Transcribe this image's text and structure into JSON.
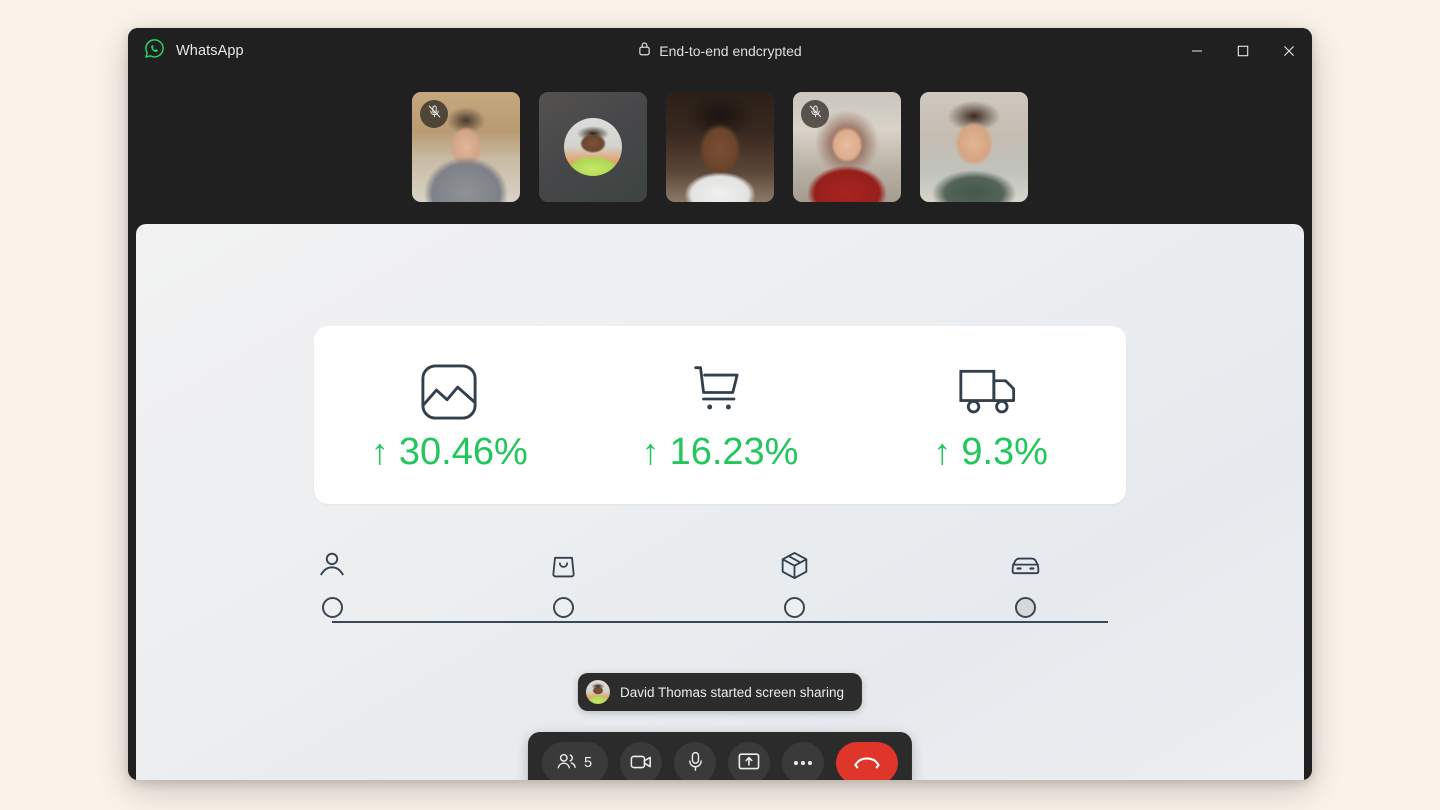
{
  "window": {
    "app_name": "WhatsApp",
    "encryption_label": "End-to-end endcrypted",
    "lock_icon": "lock-icon",
    "brand_icon": "whatsapp-logo-icon",
    "controls": {
      "minimize": "minimize-icon",
      "maximize": "maximize-icon",
      "close": "close-icon"
    },
    "colors": {
      "page_background": "#FAF3EA",
      "window_background": "#202020",
      "accent_green": "#22C75C",
      "brand_green": "#25D366",
      "end_call_red": "#E0352B"
    }
  },
  "participants": [
    {
      "name": "participant-1",
      "muted": true,
      "mode": "video",
      "mic_icon": "mic-off-icon"
    },
    {
      "name": "participant-2",
      "muted": false,
      "mode": "avatar",
      "mic_icon": ""
    },
    {
      "name": "participant-3",
      "muted": false,
      "mode": "video",
      "mic_icon": ""
    },
    {
      "name": "participant-4",
      "muted": true,
      "mode": "video",
      "mic_icon": "mic-off-icon"
    },
    {
      "name": "participant-5",
      "muted": false,
      "mode": "video",
      "mic_icon": ""
    }
  ],
  "shared_screen": {
    "stats": [
      {
        "icon": "chart-image-icon",
        "arrow": "↑",
        "value": "30.46%"
      },
      {
        "icon": "shopping-cart-icon",
        "arrow": "↑",
        "value": "16.23%"
      },
      {
        "icon": "delivery-truck-icon",
        "arrow": "↑",
        "value": "9.3%"
      }
    ],
    "timeline": [
      {
        "icon": "person-icon",
        "filled": false,
        "position": 0
      },
      {
        "icon": "shopping-bag-icon",
        "filled": false,
        "position": 29.5
      },
      {
        "icon": "package-box-icon",
        "filled": false,
        "position": 59.5
      },
      {
        "icon": "car-icon",
        "filled": true,
        "position": 88.5
      }
    ]
  },
  "toast": {
    "avatar_icon": "participant-avatar",
    "message": "David Thomas started screen sharing"
  },
  "controls": {
    "participants": {
      "icon": "people-icon",
      "count": "5"
    },
    "camera": {
      "icon": "video-camera-icon"
    },
    "microphone": {
      "icon": "microphone-icon"
    },
    "share_screen": {
      "icon": "share-screen-icon"
    },
    "more": {
      "icon": "more-options-icon"
    },
    "end_call": {
      "icon": "end-call-icon"
    }
  }
}
